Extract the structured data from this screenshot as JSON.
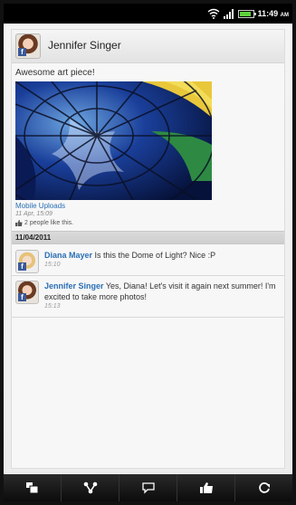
{
  "status_bar": {
    "time": "11:49",
    "time_suffix": "AM",
    "icons": [
      "wifi-icon",
      "signal-icon",
      "battery-icon"
    ]
  },
  "post": {
    "author": "Jennifer Singer",
    "text": "Awesome art piece!",
    "album": "Mobile Uploads",
    "time": "11 Apr, 15:09",
    "likes": "2 people like this."
  },
  "date_separator": "11/04/2011",
  "comments": [
    {
      "name": "Diana Mayer",
      "text": " Is this the Dome of Light? Nice :P",
      "time": "15:10"
    },
    {
      "name": "Jennifer Singer",
      "text": " Yes, Diana! Let's visit it again next summer! I'm excited to take more photos!",
      "time": "15:13"
    }
  ],
  "bottom_bar": {
    "buttons": [
      "view-post-icon",
      "share-icon",
      "comment-icon",
      "like-icon",
      "refresh-icon"
    ]
  },
  "colors": {
    "link": "#2a6fb5",
    "facebook": "#3b5998",
    "battery": "#5fd13a"
  }
}
